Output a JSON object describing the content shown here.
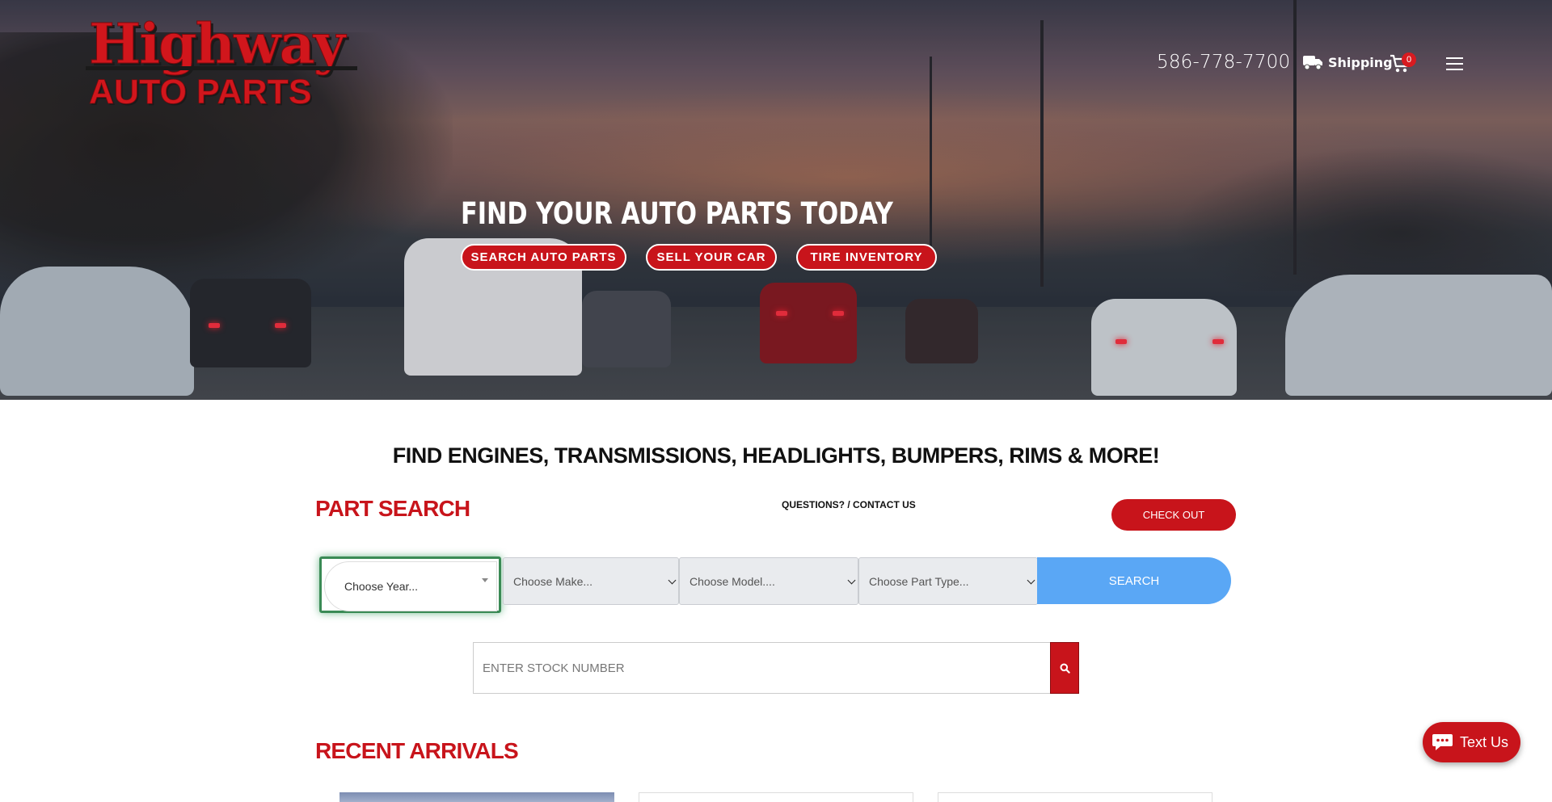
{
  "header": {
    "logo_line1": "Highway",
    "logo_line2": "AUTO PARTS",
    "phone": "586-778-7700",
    "shipping_label": "Shipping",
    "cart_count": "0"
  },
  "hero": {
    "title": "FIND YOUR AUTO PARTS TODAY",
    "buttons": [
      "SEARCH AUTO PARTS",
      "SELL YOUR CAR",
      "TIRE INVENTORY"
    ]
  },
  "main": {
    "tagline": "FIND ENGINES, TRANSMISSIONS, HEADLIGHTS, BUMPERS, RIMS & MORE!",
    "part_search_heading": "PART SEARCH",
    "questions_link": "QUESTIONS? / CONTACT US",
    "checkout_label": "CHECK OUT",
    "selects": {
      "year": "Choose Year...",
      "make": "Choose Make...",
      "model": "Choose Model....",
      "part_type": "Choose Part Type..."
    },
    "search_label": "SEARCH",
    "stock_placeholder": "ENTER STOCK NUMBER",
    "recent_arrivals_heading": "RECENT ARRIVALS"
  },
  "chat_widget": {
    "label": "Text Us"
  },
  "colors": {
    "brand_red": "#c8141b",
    "search_blue": "#5aa7f5",
    "focus_green": "#3a8a55"
  },
  "icons": [
    "truck-icon",
    "cart-icon",
    "hamburger-menu-icon",
    "search-icon",
    "chat-bubble-icon",
    "chevron-down-icon"
  ]
}
